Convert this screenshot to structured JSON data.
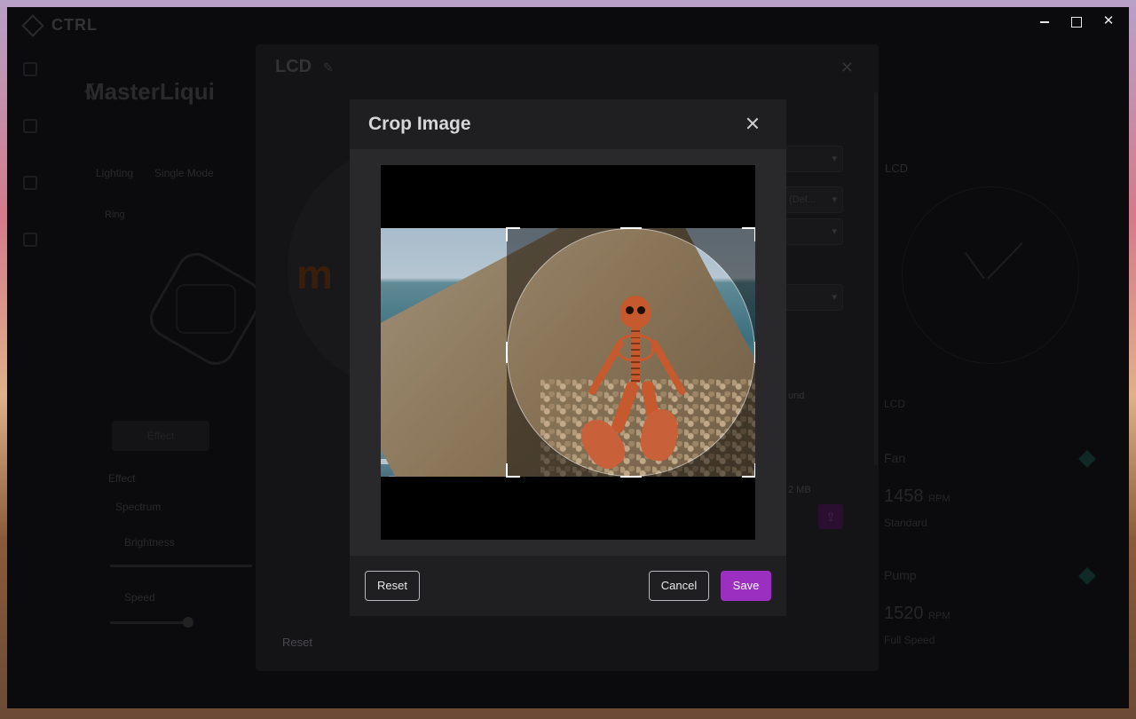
{
  "app": {
    "logo_text": "CTRL",
    "window_controls": [
      "minimize",
      "maximize",
      "close"
    ]
  },
  "background": {
    "device_title": "MasterLiqui",
    "device_subtitle": "",
    "tabs": [
      "Lighting",
      "Single Mode"
    ],
    "ring_label": "Ring",
    "effect_button": "Effect",
    "effect_label": "Effect",
    "effect_value": "Spectrum",
    "brightness_label": "Brightness",
    "speed_label": "Speed",
    "right_panel": {
      "lcd_title": "LCD",
      "lcd_label": "LCD",
      "fan_label": "Fan",
      "fan_value": "1458",
      "fan_unit": "RPM",
      "fan_mode": "Standard",
      "pump_label": "Pump",
      "pump_value": "1520",
      "pump_unit": "RPM",
      "pump_mode": "Full Speed"
    }
  },
  "lcd_panel": {
    "title": "LCD",
    "preview_text": "m",
    "select_values": [
      "",
      "(Def...",
      "",
      ""
    ],
    "background_label": "und",
    "file_size_hint": "2 MB",
    "reset_label": "Reset"
  },
  "crop_dialog": {
    "title": "Crop Image",
    "reset_label": "Reset",
    "cancel_label": "Cancel",
    "save_label": "Save",
    "accent_color": "#9b2fbf"
  }
}
